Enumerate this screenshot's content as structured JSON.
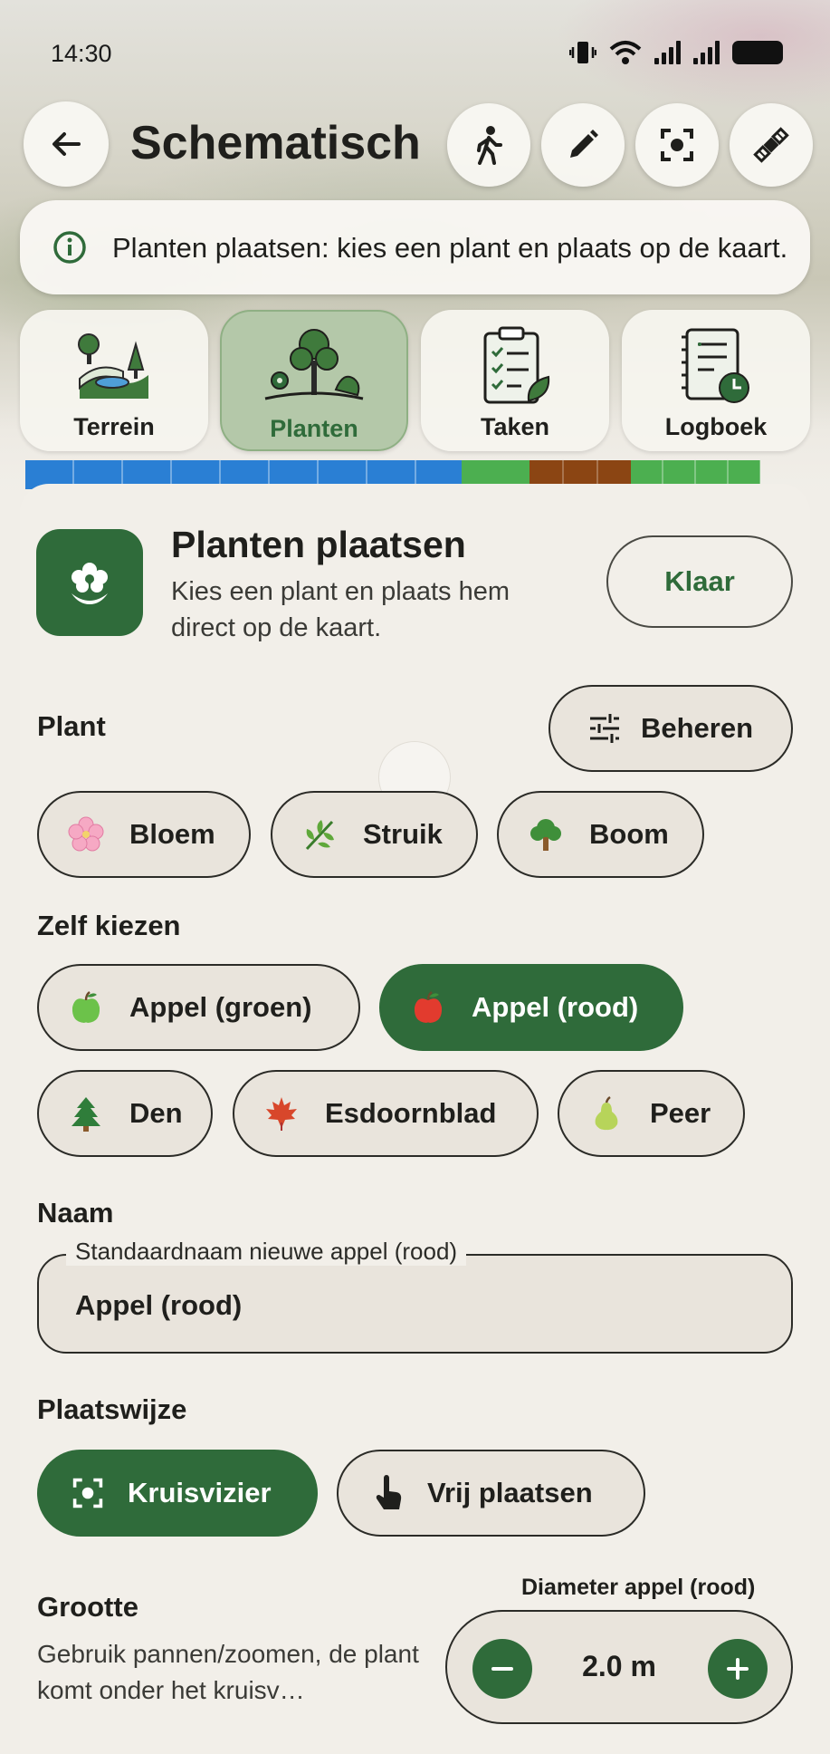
{
  "status_bar": {
    "time": "14:30"
  },
  "header": {
    "title": "Schematisch",
    "back_icon": "arrow-left-icon",
    "action_icons": [
      "walking-person-icon",
      "pencil-icon",
      "crosshair-focus-icon",
      "satellite-icon"
    ]
  },
  "info_banner": {
    "text": "Planten plaatsen: kies een plant en plaats op de kaart."
  },
  "tabs": [
    {
      "label": "Terrein",
      "icon": "terrain-icon",
      "active": false
    },
    {
      "label": "Planten",
      "icon": "plants-icon",
      "active": true
    },
    {
      "label": "Taken",
      "icon": "clipboard-checklist-icon",
      "active": false
    },
    {
      "label": "Logboek",
      "icon": "logbook-clock-icon",
      "active": false
    }
  ],
  "strip_colors": [
    "#2a7fd4",
    "#4caf50",
    "#8b4513",
    "#4caf50"
  ],
  "sheet": {
    "title": "Planten plaatsen",
    "subtitle": "Kies een plant en plaats hem direct op de kaart.",
    "done_label": "Klaar"
  },
  "plant": {
    "label": "Plant",
    "manage_label": "Beheren",
    "categories": [
      {
        "label": "Bloem",
        "icon": "cherry-blossom-icon"
      },
      {
        "label": "Struik",
        "icon": "herb-icon"
      },
      {
        "label": "Boom",
        "icon": "deciduous-tree-icon"
      }
    ]
  },
  "custom": {
    "label": "Zelf kiezen",
    "options": [
      {
        "label": "Appel (groen)",
        "icon": "green-apple-icon",
        "selected": false
      },
      {
        "label": "Appel (rood)",
        "icon": "red-apple-icon",
        "selected": true
      },
      {
        "label": "Den",
        "icon": "evergreen-tree-icon",
        "selected": false
      },
      {
        "label": "Esdoornblad",
        "icon": "maple-leaf-icon",
        "selected": false
      },
      {
        "label": "Peer",
        "icon": "pear-icon",
        "selected": false
      }
    ]
  },
  "name": {
    "label": "Naam",
    "field_label": "Standaardnaam nieuwe appel (rood)",
    "value": "Appel (rood)"
  },
  "placement": {
    "label": "Plaatswijze",
    "options": [
      {
        "label": "Kruisvizier",
        "icon": "crosshair-focus-icon",
        "selected": true
      },
      {
        "label": "Vrij plaatsen",
        "icon": "tap-finger-icon",
        "selected": false
      }
    ]
  },
  "size": {
    "label": "Grootte",
    "description": "Gebruik pannen/zoomen, de plant komt onder het kruisv…",
    "diameter_label": "Diameter appel (rood)",
    "value": "2.0 m"
  },
  "colors": {
    "primary": "#2f6b3a",
    "chip_bg": "#e9e4dc",
    "sheet_bg": "#f2efe9"
  }
}
